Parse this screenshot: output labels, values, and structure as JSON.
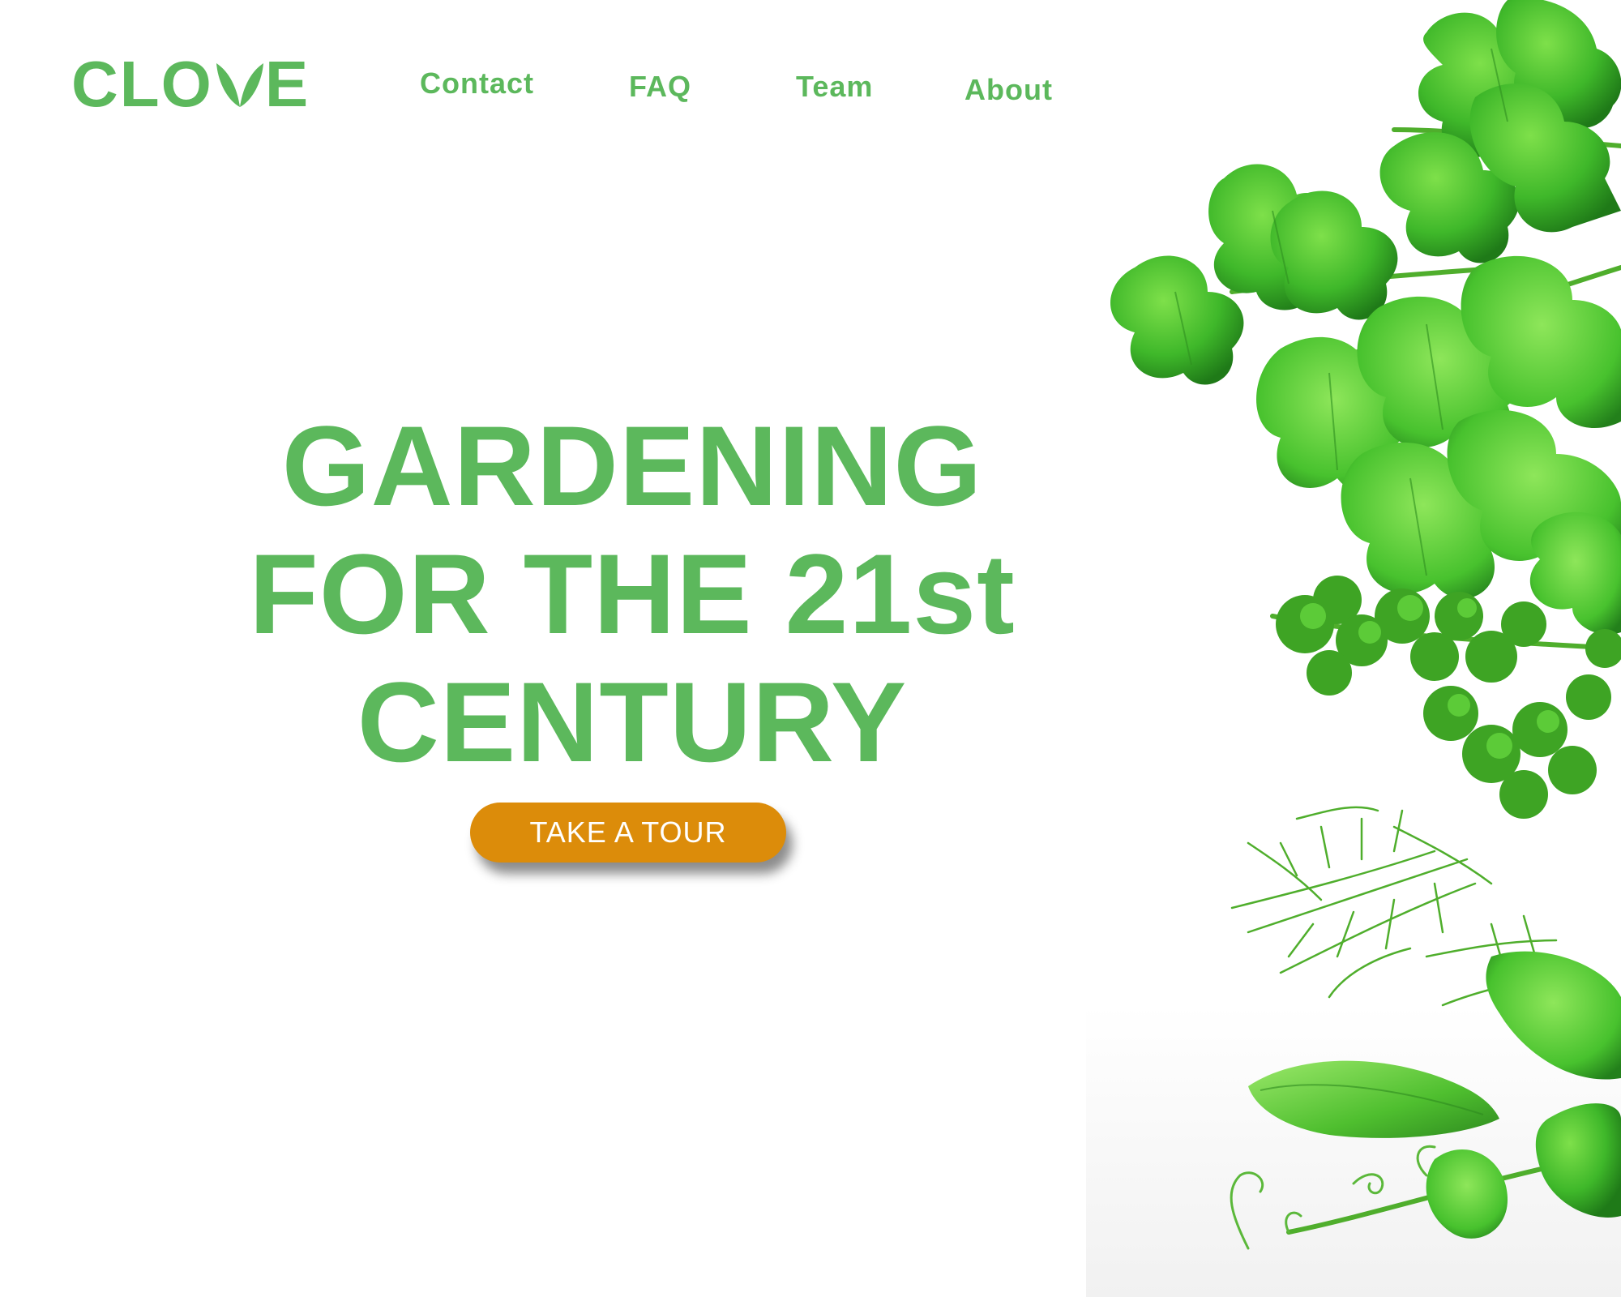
{
  "brand": {
    "name_prefix": "CLO",
    "name_suffix": "E",
    "color": "#5cb85c"
  },
  "nav": {
    "contact": "Contact",
    "faq": "FAQ",
    "team": "Team",
    "about": "About"
  },
  "hero": {
    "line1": "GARDENING",
    "line2": "FOR THE 21st",
    "line3": "CENTURY",
    "cta_label": "TAKE A TOUR",
    "cta_color": "#dc8c0a"
  },
  "illustration": {
    "icon": "herbs-image"
  }
}
